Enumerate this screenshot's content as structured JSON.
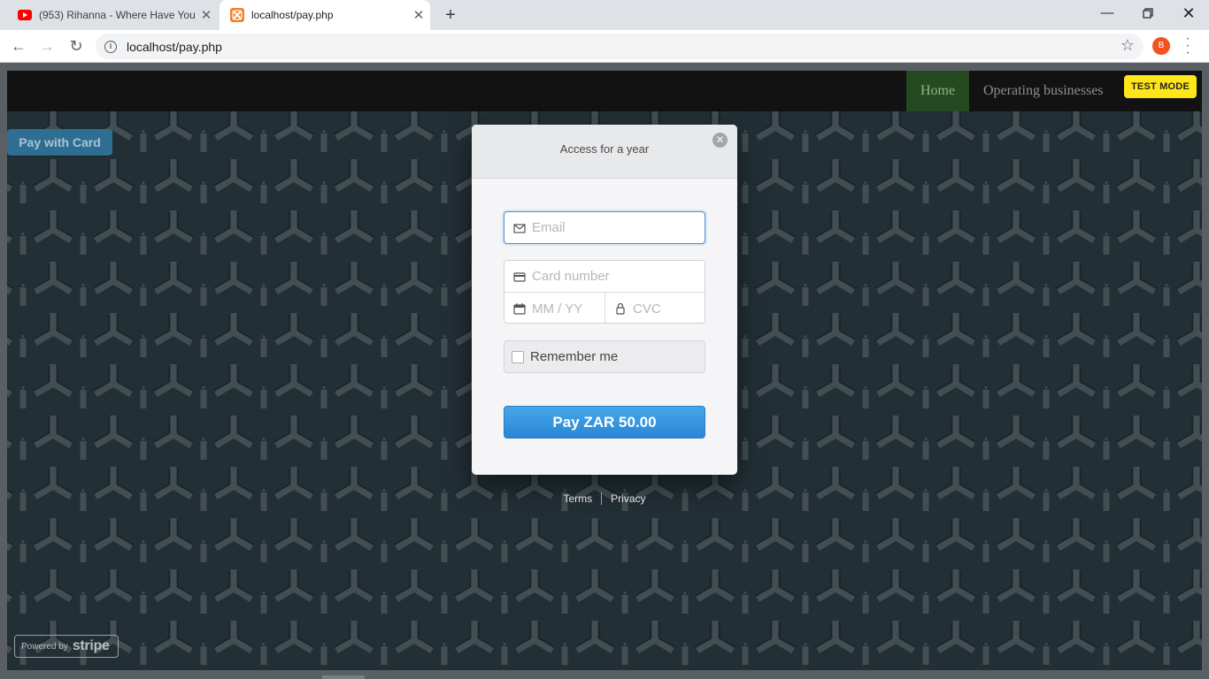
{
  "browser": {
    "tabs": [
      {
        "title": "(953) Rihanna - Where Have You",
        "favicon": "youtube-icon",
        "active": false
      },
      {
        "title": "localhost/pay.php",
        "favicon": "xampp-icon",
        "active": true
      }
    ],
    "url": "localhost/pay.php",
    "avatar_letter": "B"
  },
  "site_nav": {
    "home": "Home",
    "operating": "Operating businesses",
    "test_mode": "TEST MODE"
  },
  "page": {
    "pay_with_card": "Pay with Card",
    "powered_by": "Powered by",
    "powered_brand": "stripe"
  },
  "checkout": {
    "title": "Access for a year",
    "email_placeholder": "Email",
    "card_number_placeholder": "Card number",
    "expiry_placeholder": "MM / YY",
    "cvc_placeholder": "CVC",
    "remember_label": "Remember me",
    "pay_label": "Pay ZAR 50.00",
    "terms": "Terms",
    "privacy": "Privacy"
  },
  "colors": {
    "pattern_dark": "#25343a",
    "pattern_light": "#4d5a5f",
    "pay_button": "#2f8fdd",
    "test_mode": "#ffe61a",
    "home_bg": "#254a22"
  }
}
